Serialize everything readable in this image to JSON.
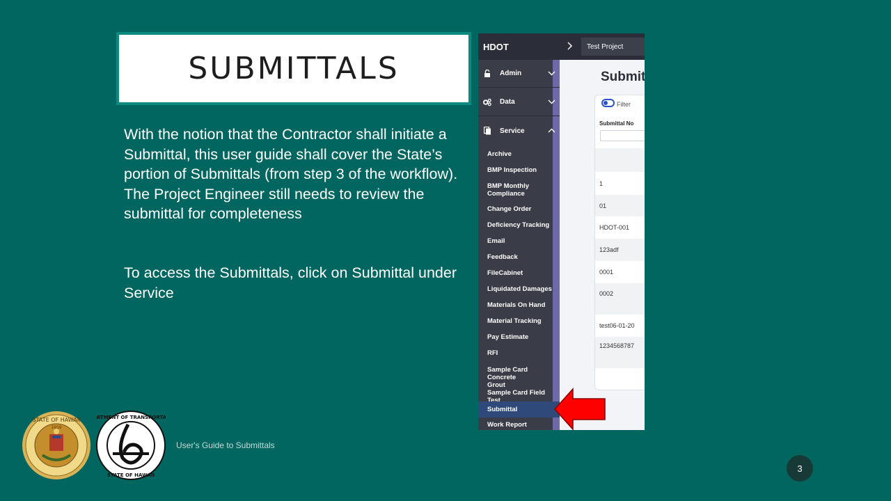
{
  "slide": {
    "title": "SUBMITTALS",
    "paragraph1": "With the notion that the Contractor shall initiate a Submittal, this user guide shall cover the State’s portion of Submittals (from step 3 of the workflow).  The Project Engineer still needs to review the submittal for completeness",
    "paragraph2": "To access the Submittals, click on Submittal under Service",
    "footer": "User's Guide to Submittals",
    "page_number": "3"
  },
  "app": {
    "brand": "HDOT",
    "breadcrumb_chevron_icon": "chevron-right-icon",
    "project": "Test Project",
    "sections": [
      {
        "label": "Admin",
        "icon": "lock-icon",
        "state": "collapsed"
      },
      {
        "label": "Data",
        "icon": "gears-icon",
        "state": "collapsed"
      },
      {
        "label": "Service",
        "icon": "documents-icon",
        "state": "expanded"
      }
    ],
    "service_items": [
      "Archive",
      "BMP Inspection",
      "BMP Monthly\nCompliance",
      "Change Order",
      "Deficiency Tracking",
      "Email",
      "Feedback",
      "FileCabinet",
      "Liquidated Damages",
      "Materials On Hand",
      "Material Tracking",
      "Pay Estimate",
      "RFI",
      "Sample Card Concrete\nGrout",
      "Sample Card Field Test",
      "Submittal",
      "Work Report"
    ],
    "active_item": "Submittal",
    "content": {
      "heading": "Submitt",
      "filter_label": "Filter",
      "column_header": "Submittal No",
      "rows": [
        "1",
        "01",
        "HDOT-001",
        "123adf",
        "0001",
        "0002",
        "test06-01-20",
        "1234568787"
      ]
    }
  },
  "colors": {
    "background": "#01665f",
    "title_border": "#0c8a80",
    "arrow": "#ff0000",
    "sidebar": "#3a3d48",
    "active": "#2f4a7a"
  }
}
